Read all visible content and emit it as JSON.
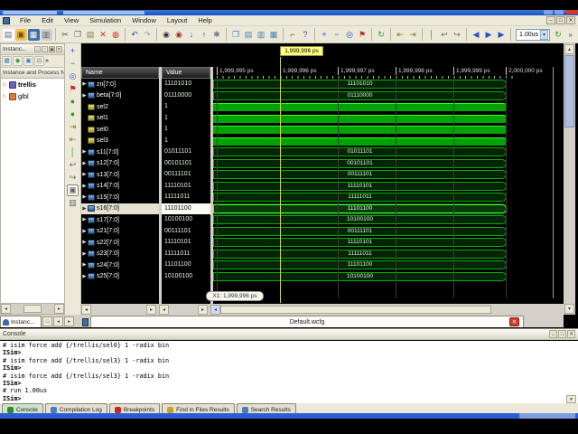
{
  "menu": {
    "items": [
      "File",
      "Edit",
      "View",
      "Simulation",
      "Window",
      "Layout",
      "Help"
    ]
  },
  "toolbar": {
    "time_value": "1.00us",
    "overflow": "»",
    "groups": [
      [
        [
          "new-icon",
          "▤",
          "#fdfdfd",
          "#556677"
        ],
        [
          "open-icon",
          "▣",
          "#f2c14e",
          "#6a4a00"
        ],
        [
          "save-icon",
          "▦",
          "#3b6ea5",
          "#ffffff"
        ],
        [
          "print-icon",
          "▥",
          "#cfcfcf",
          "#555555"
        ]
      ],
      [
        [
          "cut-icon",
          "✂",
          "",
          "#555555"
        ],
        [
          "copy-icon",
          "❐",
          "",
          "#556677"
        ],
        [
          "paste-icon",
          "▤",
          "",
          "#887755"
        ],
        [
          "delete-icon",
          "✕",
          "",
          "#bb3333"
        ],
        [
          "disable-icon",
          "◍",
          "",
          "#cc2222"
        ]
      ],
      [
        [
          "undo-icon",
          "↶",
          "",
          "#2a52be"
        ],
        [
          "redo-icon",
          "↷",
          "",
          "#88aabb"
        ]
      ],
      [
        [
          "find-icon",
          "◉",
          "",
          "#333344"
        ],
        [
          "find-clear-icon",
          "◉",
          "",
          "#aa3333"
        ],
        [
          "arrow-down-icon",
          "↓",
          "",
          "#2a52be"
        ],
        [
          "arrow-up-icon",
          "↑",
          "",
          "#2a52be"
        ],
        [
          "gear-icon",
          "✱",
          "",
          "#777788"
        ]
      ],
      [
        [
          "cascade-icon",
          "❐",
          "",
          "#4a7ebb"
        ],
        [
          "tile-horizontal-icon",
          "▤",
          "",
          "#4a7ebb"
        ],
        [
          "tile-vertical-icon",
          "▥",
          "",
          "#4a7ebb"
        ],
        [
          "layout-icon",
          "▦",
          "",
          "#4a7ebb"
        ]
      ],
      [
        [
          "wrench-icon",
          "⌐",
          "",
          "#556677"
        ],
        [
          "help-icon",
          "?",
          "",
          "#2a52be"
        ]
      ],
      [
        [
          "zoom-in-icon",
          "+",
          "",
          "#2a52be"
        ],
        [
          "zoom-out-icon",
          "−",
          "",
          "#2a52be"
        ],
        [
          "zoom-full-icon",
          "◎",
          "",
          "#2a52be"
        ],
        [
          "zoom-cursor-icon",
          "⚑",
          "",
          "#cc2222"
        ]
      ],
      [
        [
          "refresh-icon",
          "↻",
          "",
          "#2e9b2e"
        ]
      ],
      [
        [
          "goto-prev-icon",
          "⇤",
          "",
          "#8a7a20"
        ],
        [
          "goto-next-icon",
          "⇥",
          "",
          "#8a7a20"
        ]
      ],
      [
        [
          "marker-icon",
          "│",
          "",
          "#2e9b2e"
        ],
        [
          "prev-transition-icon",
          "↩",
          "",
          "#666666"
        ],
        [
          "next-transition-icon",
          "↪",
          "",
          "#666666"
        ]
      ],
      [
        [
          "restart-icon",
          "◀",
          "",
          "#2a52be"
        ],
        [
          "run-icon",
          "▶",
          "",
          "#2a52be"
        ],
        [
          "run-for-icon",
          "▶",
          "",
          "#2a52be"
        ]
      ]
    ],
    "rerun": [
      "rerun-icon",
      "↻",
      "",
      "#2e9b2e"
    ]
  },
  "side_toolbar": [
    [
      "zoom-in-icon",
      "+",
      "#2a52be"
    ],
    [
      "zoom-out-icon",
      "−",
      "#2a52be"
    ],
    [
      "zoom-full-icon",
      "◎",
      "#2a52be"
    ],
    [
      "zoom-cursor-icon",
      "⚑",
      "#cc2222"
    ],
    [
      "go-to-time-icon",
      "●",
      "#2e9b2e"
    ],
    [
      "go-to-zero-icon",
      "●",
      "#2e9b2e"
    ],
    [
      "export-icon",
      "⇥",
      "#8a7a20"
    ],
    [
      "import-icon",
      "⇤",
      "#8a7a20"
    ],
    [
      "marker-icon",
      "│",
      "#2e9b2e"
    ],
    [
      "prev-edge-icon",
      "↩",
      "#666666"
    ],
    [
      "next-edge-icon",
      "↪",
      "#666666"
    ],
    [
      "snapshot-icon",
      "▣",
      "#666666"
    ],
    [
      "swap-icon",
      "▥",
      "#666666"
    ]
  ],
  "instance_panel": {
    "title": "Instanc...",
    "title_buttons": [
      "↔",
      "▫",
      "▣",
      "✕"
    ],
    "toolbar_icons": [
      [
        "objects-icon",
        "▦",
        "#4a7ebb"
      ],
      [
        "globe-icon",
        "◉",
        "#2e9b2e"
      ],
      [
        "window-icon",
        "▣",
        "#4a7ebb"
      ],
      [
        "memory-icon",
        "▤",
        "#8a8a6a"
      ]
    ],
    "overflow": "»",
    "header": "Instance and Process Name",
    "items": [
      {
        "label": "trellis",
        "color": "#6f5fc0",
        "bold": true
      },
      {
        "label": "glbl",
        "color": "#e07b39",
        "bold": false
      }
    ]
  },
  "wave": {
    "columns": {
      "name": "Name",
      "value": "Value"
    },
    "cursor_tooltip": "1,999,996 ps",
    "cursor_label": "X1: 1,999,996 ps",
    "timeline": [
      "1,999,995 ps",
      "1,999,996 ps",
      "1,999,997 ps",
      "1,999,998 ps",
      "1,999,999 ps",
      "2,000,000 ps"
    ],
    "signals": [
      {
        "name": "zn[7:0]",
        "value": "11101010",
        "type": "bus",
        "selected": false
      },
      {
        "name": "beta[7:0]",
        "value": "01110000",
        "type": "bus",
        "selected": false
      },
      {
        "name": "sel2",
        "value": "1",
        "type": "bit",
        "selected": false
      },
      {
        "name": "sel1",
        "value": "1",
        "type": "bit",
        "selected": false
      },
      {
        "name": "sel0",
        "value": "1",
        "type": "bit",
        "selected": false
      },
      {
        "name": "sel3",
        "value": "1",
        "type": "bit",
        "selected": false
      },
      {
        "name": "s11[7:0]",
        "value": "01011101",
        "type": "bus",
        "selected": false
      },
      {
        "name": "s12[7:0]",
        "value": "00101101",
        "type": "bus",
        "selected": false
      },
      {
        "name": "s13[7:0]",
        "value": "00111101",
        "type": "bus",
        "selected": false
      },
      {
        "name": "s14[7:0]",
        "value": "11110101",
        "type": "bus",
        "selected": false
      },
      {
        "name": "s15[7:0]",
        "value": "11111011",
        "type": "bus",
        "selected": false
      },
      {
        "name": "s16[7:0]",
        "value": "11101100",
        "type": "bus",
        "selected": true
      },
      {
        "name": "s17[7:0]",
        "value": "10100100",
        "type": "bus",
        "selected": false
      },
      {
        "name": "s21[7:0]",
        "value": "00111101",
        "type": "bus",
        "selected": false
      },
      {
        "name": "s22[7:0]",
        "value": "11110101",
        "type": "bus",
        "selected": false
      },
      {
        "name": "s23[7:0]",
        "value": "11111011",
        "type": "bus",
        "selected": false
      },
      {
        "name": "s24[7:0]",
        "value": "11101100",
        "type": "bus",
        "selected": false
      },
      {
        "name": "s25[7:0]",
        "value": "10100100",
        "type": "bus",
        "selected": false
      }
    ],
    "tab": "Default.wcfg"
  },
  "left_tab": "Instanc...",
  "console": {
    "title": "Console",
    "lines": [
      "# isim force add {/trellis/sel0} 1 -radix bin",
      "ISim>",
      "# isim force add {/trellis/sel3} 1 -radix bin",
      "ISim>",
      "# isim force add {/trellis/sel3} 1 -radix bin",
      "ISim>",
      "# run 1.00us",
      "ISim>"
    ],
    "tabs": [
      {
        "label": "Console",
        "color": "#2e8b2e",
        "selected": true
      },
      {
        "label": "Compilation Log",
        "color": "#4a7ebb",
        "selected": false
      },
      {
        "label": "Breakpoints",
        "color": "#cc2222",
        "selected": false
      },
      {
        "label": "Find in Files Results",
        "color": "#c8a028",
        "selected": false
      },
      {
        "label": "Search Results",
        "color": "#4a7ebb",
        "selected": false
      }
    ]
  },
  "colors": {
    "wave_green": "#00b400",
    "wave_selected": "#44ff44",
    "cursor_yellow": "#d6d63a",
    "tooltip_yellow": "#ffff7e",
    "chrome": "#ece9d8",
    "titlebar_blue": "#2a5ad4"
  }
}
